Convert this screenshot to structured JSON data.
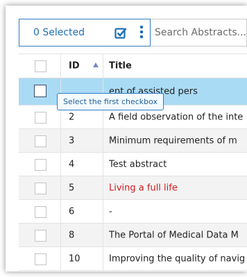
{
  "toolbar": {
    "selected_label": "0 Selected",
    "search_placeholder": "Search Abstracts...",
    "accent_color": "#1f6fb6"
  },
  "table": {
    "columns": [
      "",
      "ID",
      "Title"
    ],
    "sort": {
      "column": "ID",
      "direction": "ascending"
    },
    "rows": [
      {
        "id": "",
        "title": "ent of assisted pers",
        "selected": true
      },
      {
        "id": "2",
        "title": "A field observation of the inte"
      },
      {
        "id": "3",
        "title": "Minimum requirements of m"
      },
      {
        "id": "4",
        "title": "Test abstract"
      },
      {
        "id": "5",
        "title": "Living a full life",
        "highlight_color": "#d0191d"
      },
      {
        "id": "6",
        "title": "-"
      },
      {
        "id": "8",
        "title": "The Portal of Medical Data M"
      },
      {
        "id": "10",
        "title": "Improving the quality of navig"
      }
    ]
  },
  "tooltip": {
    "text": "Select the first checkbox"
  },
  "icons": {
    "selection": "checkbox-checked-icon",
    "more": "more-vertical-icon",
    "sort": "sort-ascending-icon"
  }
}
